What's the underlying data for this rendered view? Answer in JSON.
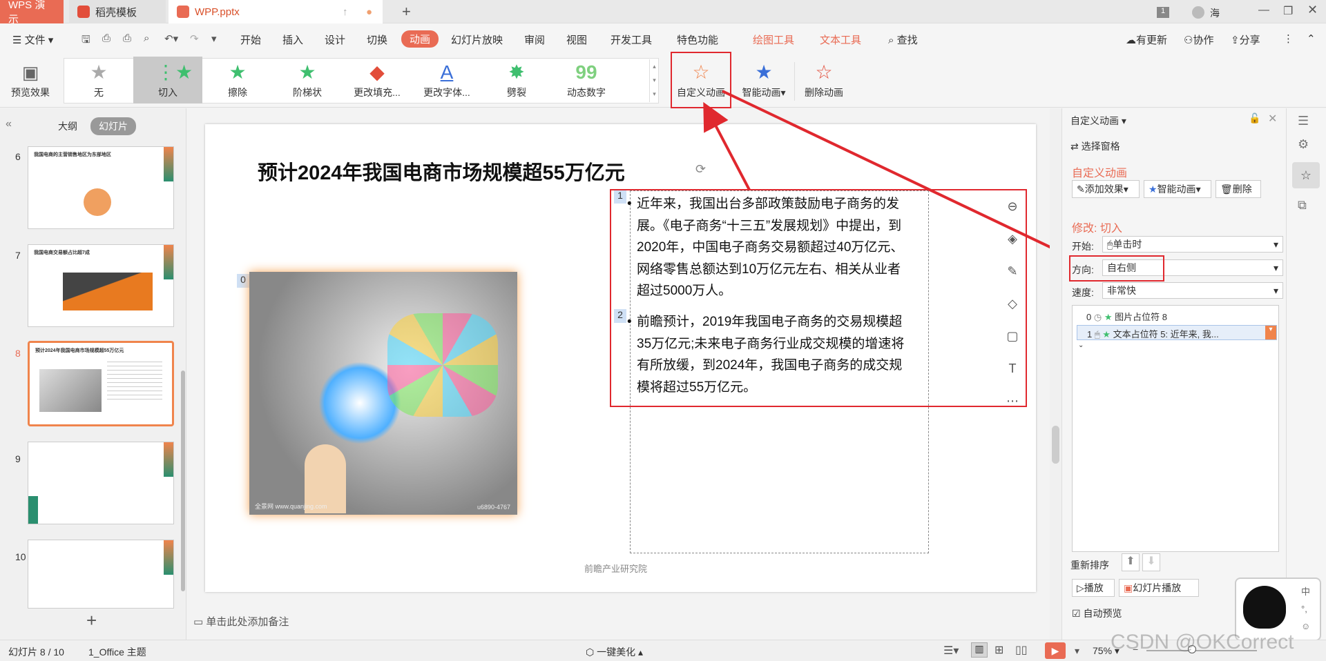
{
  "titlebar": {
    "app_tab": "WPS 演示",
    "tab1": "稻壳模板",
    "tab2": "WPP.pptx",
    "new_tab": "+",
    "page_indicator": "1",
    "user_name": "海"
  },
  "menu": {
    "file": "文件",
    "items": [
      "开始",
      "插入",
      "设计",
      "切换",
      "动画",
      "幻灯片放映",
      "审阅",
      "视图",
      "开发工具",
      "特色功能"
    ],
    "active": "动画",
    "tool1": "绘图工具",
    "tool2": "文本工具",
    "search": "查找",
    "update": "有更新",
    "collab": "协作",
    "share": "分享"
  },
  "ribbon": {
    "preview": "预览效果",
    "effects": [
      "无",
      "切入",
      "擦除",
      "阶梯状",
      "更改填充...",
      "更改字体...",
      "劈裂",
      "动态数字"
    ],
    "custom_anim": "自定义动画",
    "smart_anim": "智能动画",
    "delete_anim": "删除动画"
  },
  "leftpanel": {
    "outline_tab": "大纲",
    "slides_tab": "幻灯片",
    "numbers": [
      "6",
      "7",
      "8",
      "9",
      "10"
    ],
    "thumb6_title": "我国电商的主营销售地区为东部地区",
    "thumb7_title": "我国电商交易额占比超7成",
    "thumb8_title": "预计2024年我国电商市场规模超55万亿元",
    "add": "+"
  },
  "slide": {
    "title": "预计2024年我国电商市场规模超55万亿元",
    "tag0": "0",
    "tag1": "1",
    "tag2": "2",
    "bullet1": "近年来，我国出台多部政策鼓励电子商务的发展。《电子商务“十三五”发展规划》中提出，到2020年，中国电子商务交易额超过40万亿元、网络零售总额达到10万亿元左右、相关从业者超过5000万人。",
    "bullet2": "前瞻预计，2019年我国电子商务的交易规模超35万亿元;未来电子商务行业成交规模的增速将有所放缓，到2024年，我国电子商务的成交规模将超过55万亿元。",
    "source": "前瞻产业研究院",
    "img_watermark": "全景网 www.quanjing.com",
    "img_id": "u6890-4767"
  },
  "notes": "单击此处添加备注",
  "rightpanel": {
    "header": "自定义动画",
    "select_pane": "选择窗格",
    "section": "自定义动画",
    "add_effect": "添加效果",
    "smart_anim": "智能动画",
    "delete": "删除",
    "modify": "修改: 切入",
    "start_label": "开始:",
    "start_value": "单击时",
    "dir_label": "方向:",
    "dir_value": "自右侧",
    "speed_label": "速度:",
    "speed_value": "非常快",
    "list": [
      {
        "num": "0",
        "text": "图片占位符 8"
      },
      {
        "num": "1",
        "text": "文本占位符 5: 近年来, 我..."
      }
    ],
    "reorder": "重新排序",
    "play": "播放",
    "slideshow": "幻灯片播放",
    "autopreview": "自动预览"
  },
  "status": {
    "slide_info": "幻灯片 8 / 10",
    "theme": "1_Office 主题",
    "beautify": "一键美化",
    "zoom": "75%",
    "watermark": "CSDN @OKCorrect"
  },
  "colors": {
    "accent": "#e96b54",
    "annotation": "#e0282e",
    "effect_green": "#3fbf6f"
  }
}
